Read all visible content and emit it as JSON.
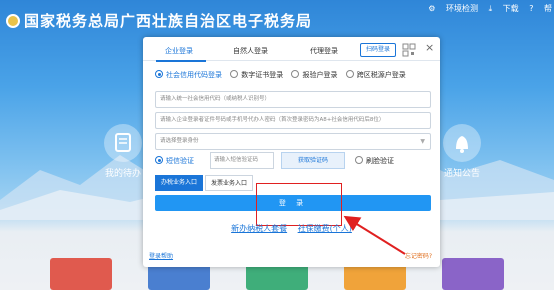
{
  "site": {
    "title": "国家税务总局广西壮族自治区电子税务局"
  },
  "top_links": {
    "env_check": "环境检测",
    "download": "下载",
    "help": "帮"
  },
  "side_tiles": {
    "left_label": "我的待办",
    "right_label": "通知公告"
  },
  "modal": {
    "tabs": [
      "企业登录",
      "自然人登录",
      "代理登录"
    ],
    "active_tab_index": 0,
    "scan_login": "扫码登录",
    "close": "×",
    "login_options": [
      "社会信用代码登录",
      "数字证书登录",
      "报验户登录",
      "跨区税源户登录"
    ],
    "selected_option_index": 0,
    "credit_code_placeholder": "请输入统一社会信用代码（或纳税人识别号）",
    "password_placeholder": "请输入企业登录者证件号码或手机号代办人密码（首次登录密码为A8+社会信用代码后8位）",
    "identity_placeholder": "请选择登录身份",
    "sms_label": "短信验证",
    "sms_code_placeholder": "请输入短信验证码",
    "get_code_button": "获取验证码",
    "face_verify_label": "刷脸验证",
    "entry_tabs": [
      "办税业务入口",
      "发票业务入口"
    ],
    "login_button": "登 录",
    "links": [
      "新办纳税人套餐",
      "社保缴费(个人)"
    ],
    "footer_help": "登录帮助",
    "forgot_password": "忘记密码?"
  },
  "colors": {
    "accent": "#1a75d8",
    "annotation": "#e02020"
  }
}
